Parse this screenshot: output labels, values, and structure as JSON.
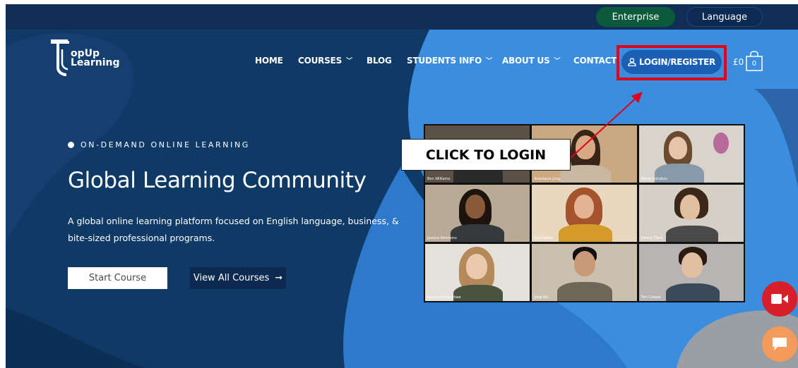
{
  "topbar": {
    "enterprise_label": "Enterprise",
    "language_label": "Language"
  },
  "logo": {
    "line1": "opUp",
    "line2": "Learning"
  },
  "nav": {
    "items": [
      {
        "label": "HOME",
        "has_dropdown": false
      },
      {
        "label": "COURSES",
        "has_dropdown": true
      },
      {
        "label": "BLOG",
        "has_dropdown": false
      },
      {
        "label": "STUDENTS INFO",
        "has_dropdown": true
      },
      {
        "label": "ABOUT US",
        "has_dropdown": true
      },
      {
        "label": "CONTACT",
        "has_dropdown": false
      }
    ],
    "login_label": "LOGIN/REGISTER",
    "cart_price": "£0",
    "cart_count": "0"
  },
  "hero": {
    "kicker": "ON-DEMAND ONLINE LEARNING",
    "title": "Global Learning Community",
    "subtitle": "A global online learning platform focused on English language, business, & bite-sized professional programs.",
    "start_label": "Start Course",
    "view_label": "View All Courses"
  },
  "annotation": {
    "callout": "CLICK TO LOGIN"
  },
  "video_tiles": [
    {
      "name": "Ben Williams"
    },
    {
      "name": "Anastasia Jung"
    },
    {
      "name": "Maria Ivshakov"
    },
    {
      "name": "Jessica Simmons"
    },
    {
      "name": "Jina Parker"
    },
    {
      "name": "Denny Clark"
    },
    {
      "name": "Hanna White-Shaw"
    },
    {
      "name": "Jong Wu"
    },
    {
      "name": "Tim Cooper"
    }
  ],
  "colors": {
    "page_dark": "#0f3a66",
    "blob_light": "#3b8de0",
    "login_button": "#1a5fb4",
    "highlight_red": "#e0001a",
    "enterprise_green": "#0b5a3c"
  },
  "icons": {
    "user": "user-icon",
    "cart": "shopping-bag-icon",
    "arrow": "arrow-right-icon",
    "video": "video-camera-icon",
    "chat": "chat-bubble-icon"
  }
}
